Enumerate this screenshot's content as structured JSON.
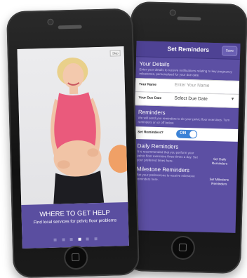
{
  "settings_screen": {
    "nav_title": "Set Reminders",
    "nav_button": "Save",
    "your_details": {
      "heading": "Your Details",
      "text": "Enter your details to receive notifications relating to key pregnancy milestones, personalised for your due date."
    },
    "fields": [
      {
        "label": "Your Name",
        "value": "Enter Your Name",
        "placeholder": true
      },
      {
        "label": "Your Due Date",
        "value": "Select Due Date",
        "placeholder": false
      }
    ],
    "reminders": {
      "heading": "Reminders",
      "text": "We will send you reminders to do your pelvic floor exercises. Turn reminders on or off below.",
      "toggle_label": "Set Reminders?",
      "toggle_value": "ON"
    },
    "daily": {
      "heading": "Daily Reminders",
      "text": "It is recommended that you perform your pelvic floor exercises three times a day. Set your preferred times here.",
      "button": "Set Daily Reminders"
    },
    "milestone": {
      "heading": "Milestone Reminders",
      "text": "Set your preferences to receive milestone reminders here.",
      "button": "Set Milestone Reminders"
    }
  },
  "onboarding_screen": {
    "skip_label": "Skip",
    "heading": "WHERE TO GET HELP",
    "subtext": "Find local services for pelvic floor problems",
    "pages": 6,
    "active_page": 3
  },
  "colors": {
    "primary": "#5c4fa3",
    "nav": "#4e4294",
    "toggle": "#3b82d6"
  }
}
